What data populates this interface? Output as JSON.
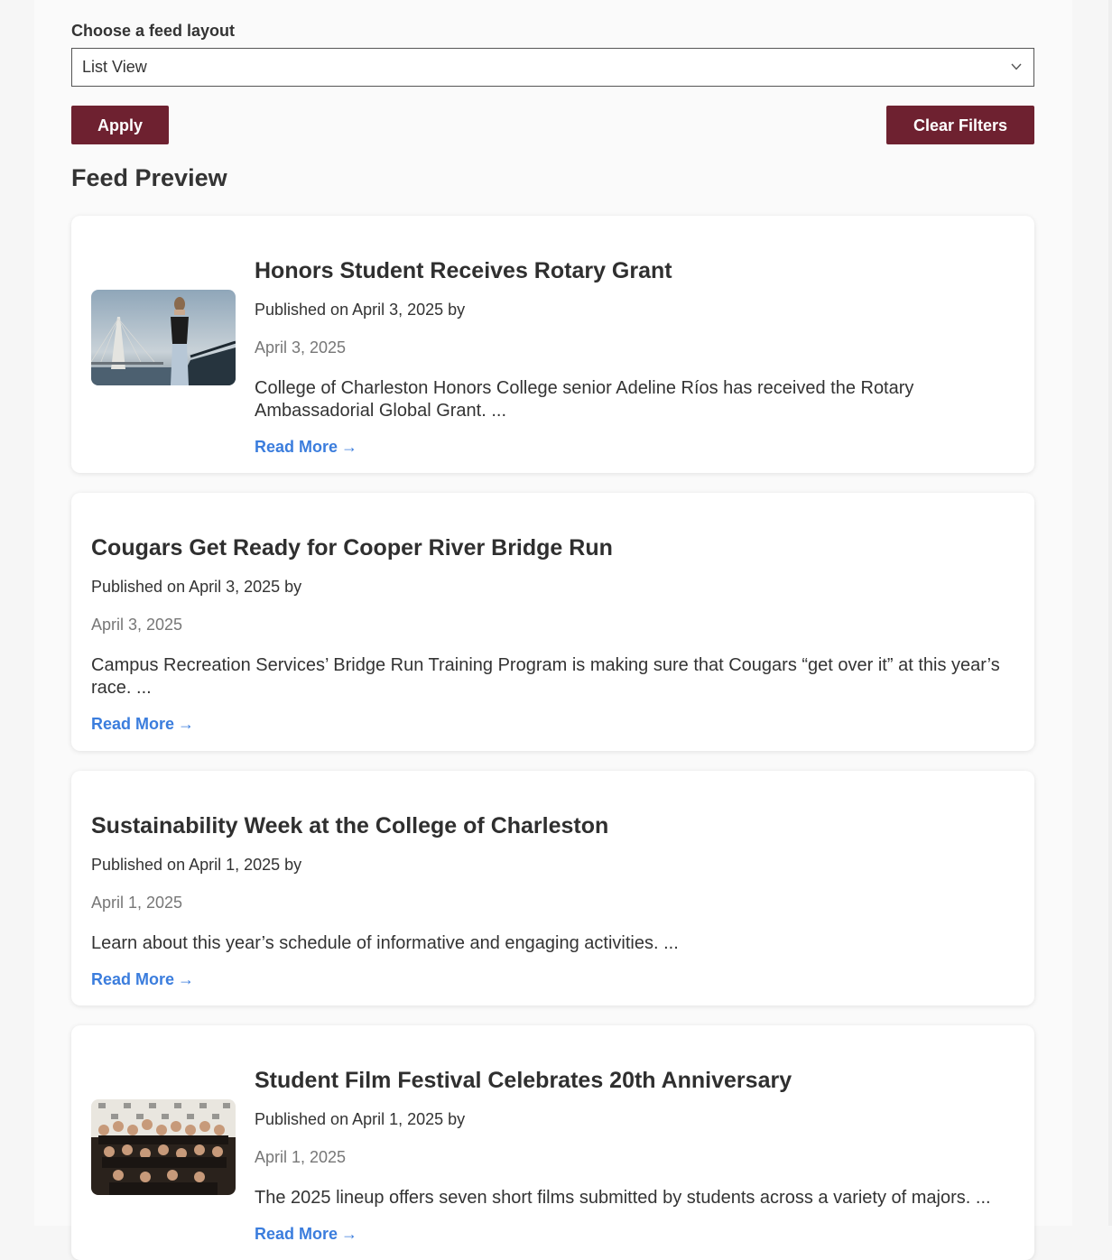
{
  "filters": {
    "layout_label": "Choose a feed layout",
    "layout_selected": "List View",
    "apply_label": "Apply",
    "clear_label": "Clear Filters"
  },
  "feed": {
    "title": "Feed Preview",
    "read_more_label": "Read More",
    "items": [
      {
        "title": "Honors Student Receives Rotary Grant",
        "byline": "Published on April 3, 2025 by",
        "date": "April 3, 2025",
        "excerpt": "College of Charleston Honors College senior Adeline Ríos has received the Rotary Ambassadorial Global Grant. ...",
        "has_image": true
      },
      {
        "title": "Cougars Get Ready for Cooper River Bridge Run",
        "byline": "Published on April 3, 2025 by",
        "date": "April 3, 2025",
        "excerpt": "Campus Recreation Services’ Bridge Run Training Program is making sure that Cougars “get over it” at this year’s race. ...",
        "has_image": false
      },
      {
        "title": "Sustainability Week at the College of Charleston",
        "byline": "Published on April 1, 2025 by",
        "date": "April 1, 2025",
        "excerpt": "Learn about this year’s schedule of informative and engaging activities. ...",
        "has_image": false
      },
      {
        "title": "Student Film Festival Celebrates 20th Anniversary",
        "byline": "Published on April 1, 2025 by",
        "date": "April 1, 2025",
        "excerpt": "The 2025 lineup offers seven short films submitted by students across a variety of majors. ...",
        "has_image": true
      }
    ]
  },
  "colors": {
    "button_bg": "#6e2130",
    "link": "#3b7ddd",
    "muted_text": "#777777"
  },
  "icons": {
    "select_chevron": "chevron-down-icon",
    "read_more_arrow": "arrow-right-icon"
  }
}
